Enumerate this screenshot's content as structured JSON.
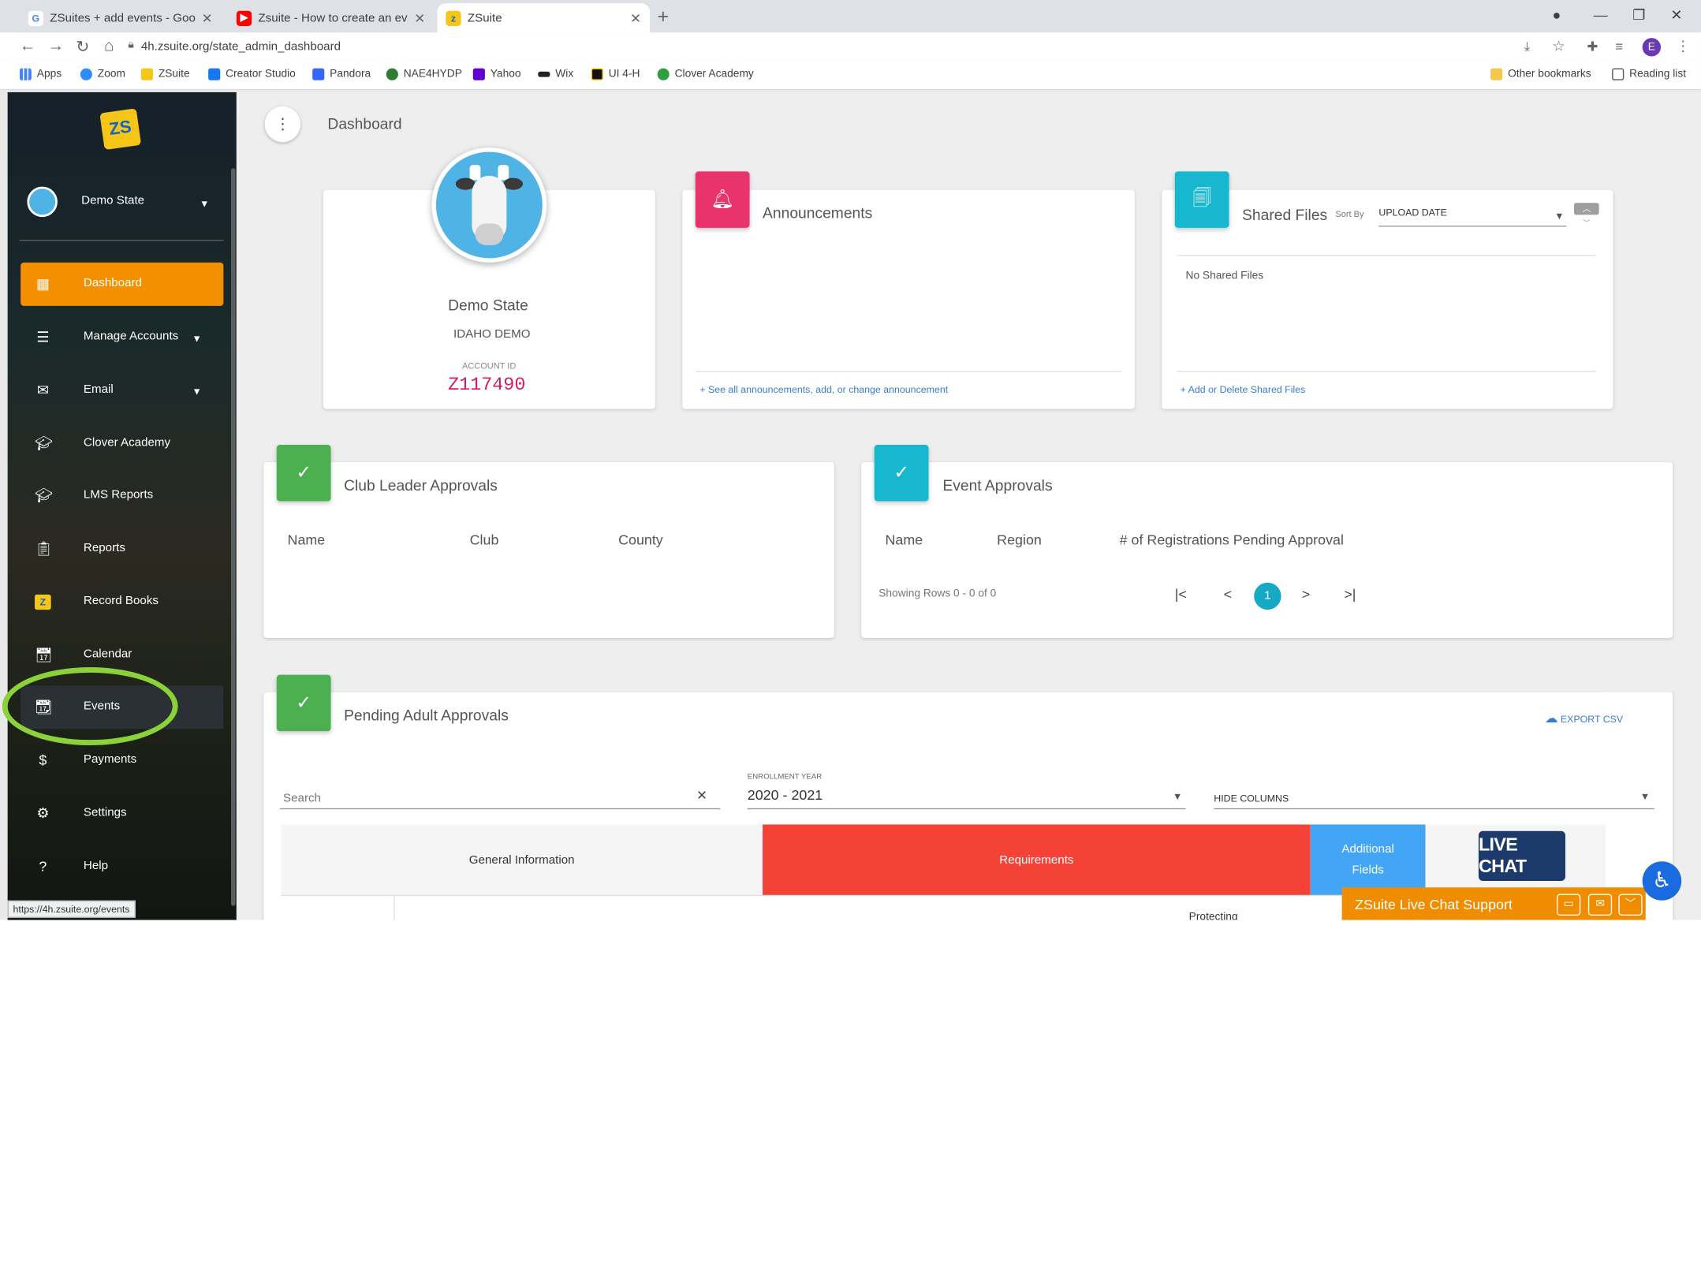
{
  "browser": {
    "tabs": [
      {
        "title": "ZSuites + add events - Google Sl",
        "favicon": "google-g"
      },
      {
        "title": "Zsuite - How to create an event",
        "favicon": "youtube"
      },
      {
        "title": "ZSuite",
        "favicon": "zsuite"
      }
    ],
    "url": "4h.zsuite.org/state_admin_dashboard",
    "profile_initial": "E",
    "bookmarks": [
      "Apps",
      "Zoom",
      "ZSuite",
      "Creator Studio",
      "Pandora",
      "NAE4HYDP",
      "Yahoo",
      "Wix",
      "UI 4-H",
      "Clover Academy"
    ],
    "other_bookmarks": "Other bookmarks",
    "reading_list": "Reading list",
    "status_url": "https://4h.zsuite.org/events"
  },
  "sidebar": {
    "profile_name": "Demo State",
    "items": [
      {
        "label": "Dashboard",
        "icon": "dashboard-icon",
        "active": true
      },
      {
        "label": "Manage Accounts",
        "icon": "list-icon",
        "has_caret": true
      },
      {
        "label": "Email",
        "icon": "mail-icon",
        "has_caret": true
      },
      {
        "label": "Clover Academy",
        "icon": "graduation-cap-icon"
      },
      {
        "label": "LMS Reports",
        "icon": "graduation-cap-icon"
      },
      {
        "label": "Reports",
        "icon": "clipboard-icon"
      },
      {
        "label": "Record Books",
        "icon": "zsuite-icon"
      },
      {
        "label": "Calendar",
        "icon": "calendar-icon"
      },
      {
        "label": "Events",
        "icon": "calendar-event-icon",
        "highlighted": true
      },
      {
        "label": "Payments",
        "icon": "dollar-icon"
      },
      {
        "label": "Settings",
        "icon": "gear-icon"
      },
      {
        "label": "Help",
        "icon": "help-icon"
      }
    ],
    "highlight_color": "#8bd23a"
  },
  "header": {
    "title": "Dashboard"
  },
  "profile_card": {
    "name": "Demo State",
    "org": "IDAHO DEMO",
    "account_label": "ACCOUNT ID",
    "account_id": "Z117490"
  },
  "announcements": {
    "title": "Announcements",
    "link": "See all announcements, add, or change announcement",
    "color": "#e8336d"
  },
  "shared_files": {
    "title": "Shared Files",
    "sort_label": "Sort By",
    "sort_value": "UPLOAD DATE",
    "empty": "No Shared Files",
    "link": "Add or Delete Shared Files",
    "color": "#17b7cf"
  },
  "club_leader": {
    "title": "Club Leader Approvals",
    "columns": [
      "Name",
      "Club",
      "County"
    ],
    "color": "#4caf50"
  },
  "event_approvals": {
    "title": "Event Approvals",
    "columns": [
      "Name",
      "Region",
      "# of Registrations Pending Approval"
    ],
    "showing": "Showing Rows 0 - 0 of 0",
    "page": "1",
    "color": "#17b7cf"
  },
  "pending_adult": {
    "title": "Pending Adult Approvals",
    "export": "EXPORT CSV",
    "search_placeholder": "Search",
    "enrollment_label": "ENROLLMENT YEAR",
    "enrollment_value": "2020 - 2021",
    "hide_columns": "HIDE COLUMNS",
    "sections": {
      "general": "General Information",
      "requirements": "Requirements",
      "additional": "Additional Fields",
      "protecting": "Protecting"
    },
    "color": "#4caf50"
  },
  "chat": {
    "badge": "LIVE CHAT",
    "bar_label": "ZSuite Live Chat Support",
    "color": "#f08c00"
  }
}
